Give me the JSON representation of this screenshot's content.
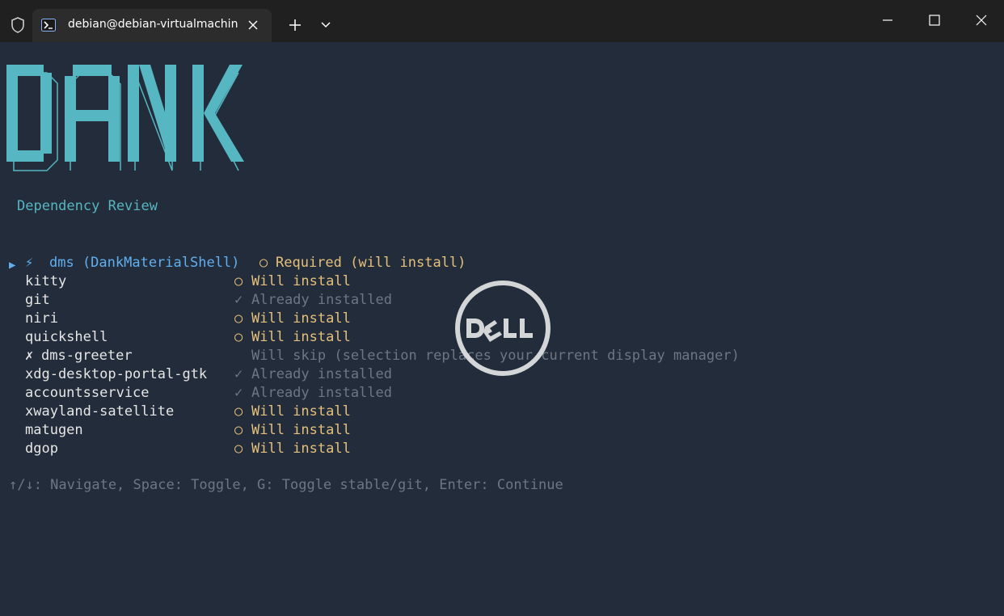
{
  "titlebar": {
    "tab_title": "debian@debian-virtualmachin",
    "icons": [
      "shield-icon",
      "terminal-icon",
      "close-tab-icon",
      "new-tab-icon",
      "dropdown-icon",
      "minimize-icon",
      "maximize-icon",
      "close-window-icon"
    ]
  },
  "logo": {
    "text": "DANK",
    "color": "#56b6c2"
  },
  "heading": "Dependency Review",
  "selected": {
    "marker": "▶",
    "bolt": "⚡",
    "name": "dms (DankMaterialShell)",
    "status_symbol": "○",
    "status": "Required (will install)"
  },
  "packages": [
    {
      "name": "kitty",
      "symbol": "○",
      "status": "Will install",
      "kind": "install"
    },
    {
      "name": "git",
      "symbol": "✓",
      "status": "Already installed",
      "kind": "installed"
    },
    {
      "name": "niri",
      "symbol": "○",
      "status": "Will install",
      "kind": "install"
    },
    {
      "name": "quickshell",
      "symbol": "○",
      "status": "Will install",
      "kind": "install"
    },
    {
      "name": "dms-greeter",
      "prefix": "✗",
      "symbol": "",
      "status": "Will skip (selection replaces your current display manager)",
      "kind": "skip"
    },
    {
      "name": "xdg-desktop-portal-gtk",
      "symbol": "✓",
      "status": "Already installed",
      "kind": "installed"
    },
    {
      "name": "accountsservice",
      "symbol": "✓",
      "status": "Already installed",
      "kind": "installed"
    },
    {
      "name": "xwayland-satellite",
      "symbol": "○",
      "status": "Will install",
      "kind": "install"
    },
    {
      "name": "matugen",
      "symbol": "○",
      "status": "Will install",
      "kind": "install"
    },
    {
      "name": "dgop",
      "symbol": "○",
      "status": "Will install",
      "kind": "install"
    }
  ],
  "help": "↑/↓: Navigate, Space: Toggle, G: Toggle stable/git, Enter: Continue",
  "watermark": {
    "text": "DELL"
  },
  "colors": {
    "background": "#222c3a",
    "accent": "#56b6c2",
    "selected": "#61afef",
    "install": "#e5c07b",
    "muted": "#6e7683"
  }
}
